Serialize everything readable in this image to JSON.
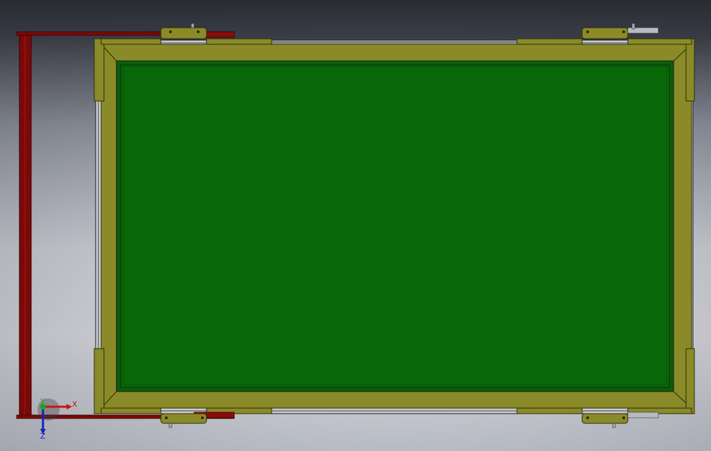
{
  "triad": {
    "x_label": "X",
    "y_label": "Y",
    "z_label": "Z",
    "x_color": "#cc1111",
    "y_color": "#11aa11",
    "z_color": "#1122bb"
  },
  "colors": {
    "panel_green": "#086608",
    "frame_olive": "#8a8a28",
    "frame_olive_dark": "#5e5e12",
    "handle_red": "#7a0a0a",
    "edge_gray": "#bfc3c8",
    "line_black": "#1a1a1a"
  },
  "parts": [
    {
      "name": "green-panel",
      "kind": "panel"
    },
    {
      "name": "olive-frame",
      "kind": "frame"
    },
    {
      "name": "red-handle-bar",
      "kind": "handle"
    },
    {
      "name": "hinge-top-left",
      "kind": "hinge"
    },
    {
      "name": "hinge-top-right",
      "kind": "hinge"
    },
    {
      "name": "hinge-bottom-left",
      "kind": "hinge"
    },
    {
      "name": "hinge-bottom-right",
      "kind": "hinge"
    }
  ]
}
